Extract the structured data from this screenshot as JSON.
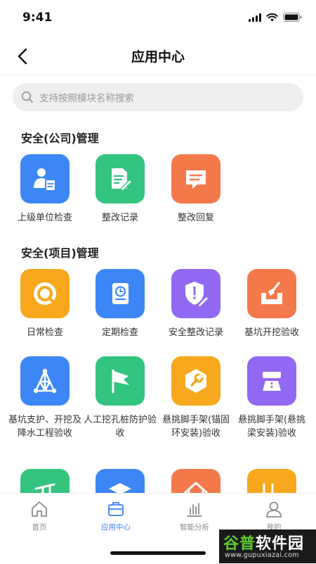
{
  "status": {
    "time": "9:41"
  },
  "nav": {
    "title": "应用中心"
  },
  "search": {
    "placeholder": "支持按照模块名称搜索"
  },
  "sections": [
    {
      "title": "安全(公司)管理",
      "items": [
        {
          "label": "上级单位检查",
          "icon": "inspector-clipboard-icon",
          "color": "#3d86f6"
        },
        {
          "label": "整改记录",
          "icon": "document-edit-icon",
          "color": "#33c47f"
        },
        {
          "label": "整改回复",
          "icon": "chat-bubble-icon",
          "color": "#f4794a"
        }
      ]
    },
    {
      "title": "安全(项目)管理",
      "items": [
        {
          "label": "日常检查",
          "icon": "target-ring-icon",
          "color": "#f7a81d"
        },
        {
          "label": "定期检查",
          "icon": "clock-notebook-icon",
          "color": "#3d86f6"
        },
        {
          "label": "安全整改记录",
          "icon": "shield-edit-icon",
          "color": "#9169f3"
        },
        {
          "label": "基坑开挖验收",
          "icon": "shovel-pit-icon",
          "color": "#f4794a"
        },
        {
          "label": "基坑支护、开挖及降水工程验收",
          "icon": "truss-icon",
          "color": "#3d86f6"
        },
        {
          "label": "人工挖孔桩防护验收",
          "icon": "flag-icon",
          "color": "#33c47f"
        },
        {
          "label": "悬挑脚手架(锚固环安装)验收",
          "icon": "wrench-hexagon-icon",
          "color": "#f7a81d"
        },
        {
          "label": "悬挑脚手架(悬挑梁安装)验收",
          "icon": "road-barrier-icon",
          "color": "#9169f3"
        },
        {
          "label": "",
          "icon": "crane-icon",
          "color": "#33c47f"
        },
        {
          "label": "",
          "icon": "layers-icon",
          "color": "#3d86f6"
        },
        {
          "label": "",
          "icon": "roof-frame-icon",
          "color": "#f4794a"
        },
        {
          "label": "",
          "icon": "formwork-icon",
          "color": "#f7a81d"
        }
      ]
    }
  ],
  "tabs": [
    {
      "label": "首页",
      "icon": "home-icon",
      "active": false
    },
    {
      "label": "应用中心",
      "icon": "briefcase-icon",
      "active": true
    },
    {
      "label": "智能分析",
      "icon": "bar-chart-icon",
      "active": false
    },
    {
      "label": "我的",
      "icon": "user-icon",
      "active": false
    }
  ],
  "watermark": {
    "brand_prefix": "谷普",
    "brand_suffix": "软件园",
    "url": "www.gupuxiazai.com"
  },
  "colors": {
    "accent": "#3f7ef5",
    "inactive_tab": "#8a8a8a"
  }
}
